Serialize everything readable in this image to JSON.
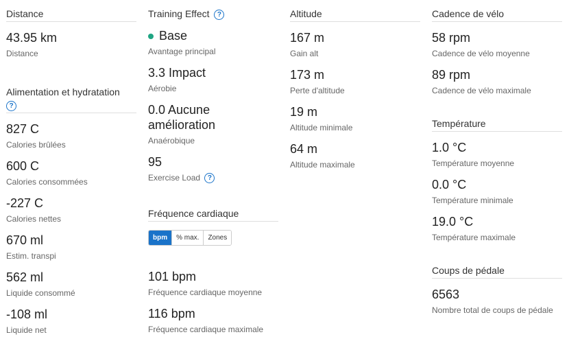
{
  "distance": {
    "title": "Distance",
    "stats": [
      {
        "value": "43.95 km",
        "label": "Distance"
      }
    ]
  },
  "nutrition": {
    "title": "Alimentation et hydratation",
    "stats": [
      {
        "value": "827 C",
        "label": "Calories brûlées"
      },
      {
        "value": "600 C",
        "label": "Calories consommées"
      },
      {
        "value": "-227 C",
        "label": "Calories nettes"
      },
      {
        "value": "670 ml",
        "label": "Estim. transpi"
      },
      {
        "value": "562 ml",
        "label": "Liquide consommé"
      },
      {
        "value": "-108 ml",
        "label": "Liquide net"
      }
    ]
  },
  "training_effect": {
    "title": "Training Effect",
    "stats": [
      {
        "value": "Base",
        "label": "Avantage principal"
      },
      {
        "value": "3.3 Impact",
        "label": "Aérobie"
      },
      {
        "value": "0.0 Aucune amélioration",
        "label": "Anaérobique"
      },
      {
        "value": "95",
        "label": "Exercise Load"
      }
    ]
  },
  "heart_rate": {
    "title": "Fréquence cardiaque",
    "toggle": [
      "bpm",
      "% max.",
      "Zones"
    ],
    "stats": [
      {
        "value": "101 bpm",
        "label": "Fréquence cardiaque moyenne"
      },
      {
        "value": "116 bpm",
        "label": "Fréquence cardiaque maximale"
      }
    ]
  },
  "altitude": {
    "title": "Altitude",
    "stats": [
      {
        "value": "167 m",
        "label": "Gain alt"
      },
      {
        "value": "173 m",
        "label": "Perte d'altitude"
      },
      {
        "value": "19 m",
        "label": "Altitude minimale"
      },
      {
        "value": "64 m",
        "label": "Altitude maximale"
      }
    ]
  },
  "cadence": {
    "title": "Cadence de vélo",
    "stats": [
      {
        "value": "58 rpm",
        "label": "Cadence de vélo moyenne"
      },
      {
        "value": "89 rpm",
        "label": "Cadence de vélo maximale"
      }
    ]
  },
  "temperature": {
    "title": "Température",
    "stats": [
      {
        "value": "1.0 °C",
        "label": "Température moyenne"
      },
      {
        "value": "0.0 °C",
        "label": "Température minimale"
      },
      {
        "value": "19.0 °C",
        "label": "Température maximale"
      }
    ]
  },
  "pedal": {
    "title": "Coups de pédale",
    "stats": [
      {
        "value": "6563",
        "label": "Nombre total de coups de pédale"
      }
    ]
  },
  "help_glyph": "?"
}
